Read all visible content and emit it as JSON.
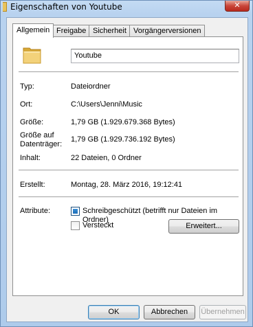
{
  "window": {
    "title": "Eigenschaften von Youtube",
    "close_label": "✕"
  },
  "tabs": [
    {
      "label": "Allgemein",
      "active": true
    },
    {
      "label": "Freigabe",
      "active": false
    },
    {
      "label": "Sicherheit",
      "active": false
    },
    {
      "label": "Vorgängerversionen",
      "active": false
    }
  ],
  "general": {
    "name_value": "Youtube",
    "type_label": "Typ:",
    "type_value": "Dateiordner",
    "location_label": "Ort:",
    "location_value": "C:\\Users\\Jenni\\Music",
    "size_label": "Größe:",
    "size_value": "1,79 GB (1.929.679.368 Bytes)",
    "disk_size_label_1": "Größe auf",
    "disk_size_label_2": "Datenträger:",
    "disk_size_value": "1,79 GB (1.929.736.192 Bytes)",
    "contents_label": "Inhalt:",
    "contents_value": "22 Dateien, 0 Ordner",
    "created_label": "Erstellt:",
    "created_value": "Montag, 28. März 2016, 19:12:41",
    "attributes_label": "Attribute:",
    "readonly_label": "Schreibgeschützt (betrifft nur Dateien im Ordner)",
    "readonly_state": "indeterminate",
    "hidden_label": "Versteckt",
    "hidden_state": "unchecked",
    "advanced_button": "Erweitert..."
  },
  "footer": {
    "ok": "OK",
    "cancel": "Abbrechen",
    "apply": "Übernehmen"
  },
  "icons": {
    "title": "folder-icon",
    "main": "folder-icon"
  }
}
